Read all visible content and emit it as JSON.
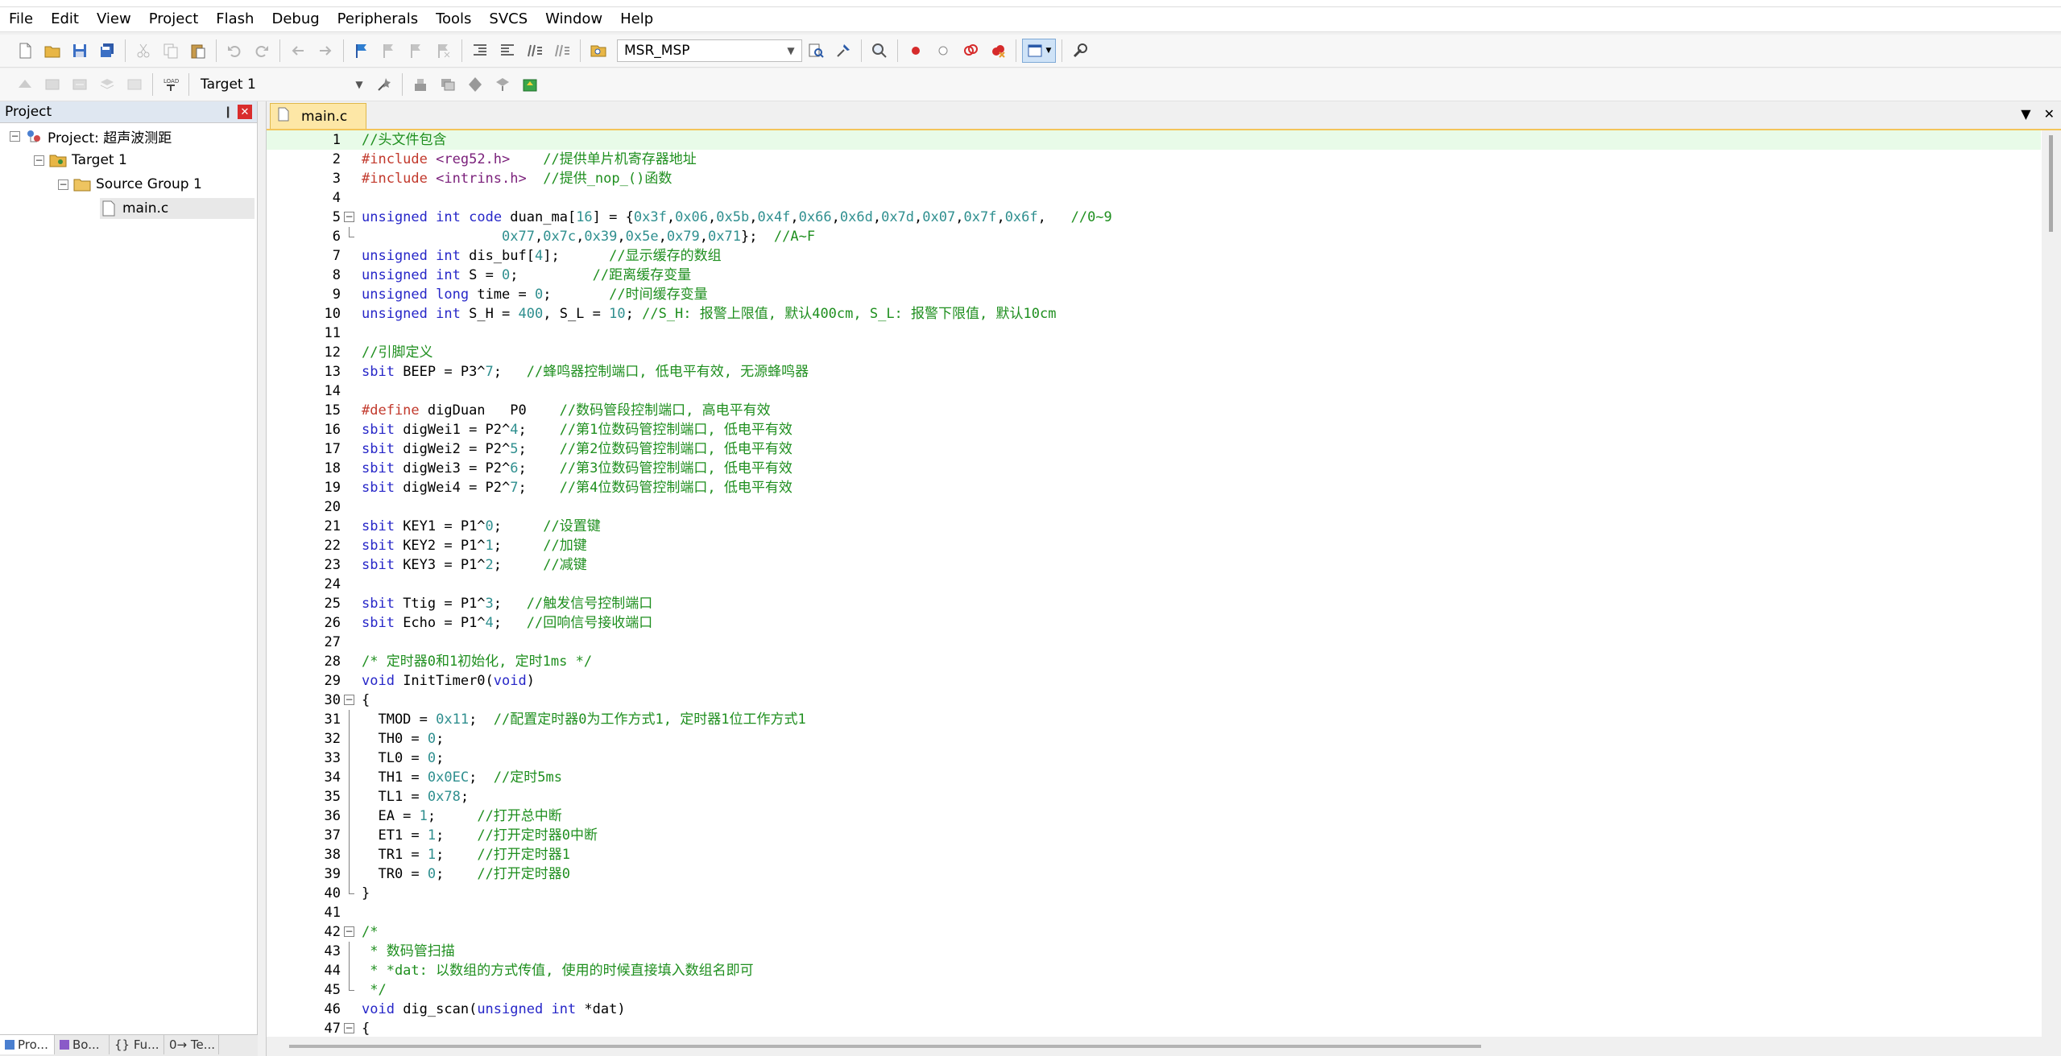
{
  "menu": [
    "File",
    "Edit",
    "View",
    "Project",
    "Flash",
    "Debug",
    "Peripherals",
    "Tools",
    "SVCS",
    "Window",
    "Help"
  ],
  "toolbar": {
    "find_combo_value": "MSR_MSP",
    "target_combo_value": "Target 1"
  },
  "project_panel": {
    "title": "Project",
    "pin_glyph": "❙",
    "close_glyph": "✕",
    "tree": {
      "root": "Project: 超声波测距",
      "target": "Target 1",
      "group": "Source Group 1",
      "file": "main.c"
    },
    "bottom_tabs": [
      "Pro...",
      "Bo...",
      "{} Fu...",
      "0→ Te..."
    ]
  },
  "editor": {
    "active_tab": "main.c",
    "tab_menu_glyph": "▼",
    "tab_close_glyph": "✕",
    "current_line": 1,
    "lines": [
      "//头文件包含",
      "#include <reg52.h>    //提供单片机寄存器地址",
      "#include <intrins.h>  //提供_nop_()函数",
      "",
      "unsigned int code duan_ma[16] = {0x3f,0x06,0x5b,0x4f,0x66,0x6d,0x7d,0x07,0x7f,0x6f,   //0~9",
      "                 0x77,0x7c,0x39,0x5e,0x79,0x71};  //A~F",
      "unsigned int dis_buf[4];      //显示缓存的数组",
      "unsigned int S = 0;         //距离缓存变量",
      "unsigned long time = 0;       //时间缓存变量",
      "unsigned int S_H = 400, S_L = 10; //S_H: 报警上限值, 默认400cm, S_L: 报警下限值, 默认10cm",
      "",
      "//引脚定义",
      "sbit BEEP = P3^7;   //蜂鸣器控制端口, 低电平有效, 无源蜂鸣器",
      "",
      "#define digDuan   P0    //数码管段控制端口, 高电平有效",
      "sbit digWei1 = P2^4;    //第1位数码管控制端口, 低电平有效",
      "sbit digWei2 = P2^5;    //第2位数码管控制端口, 低电平有效",
      "sbit digWei3 = P2^6;    //第3位数码管控制端口, 低电平有效",
      "sbit digWei4 = P2^7;    //第4位数码管控制端口, 低电平有效",
      "",
      "sbit KEY1 = P1^0;     //设置键",
      "sbit KEY2 = P1^1;     //加键",
      "sbit KEY3 = P1^2;     //减键",
      "",
      "sbit Ttig = P1^3;   //触发信号控制端口",
      "sbit Echo = P1^4;   //回响信号接收端口",
      "",
      "/* 定时器0和1初始化, 定时1ms */",
      "void InitTimer0(void)",
      "{",
      "  TMOD = 0x11;  //配置定时器0为工作方式1, 定时器1位工作方式1",
      "  TH0 = 0;",
      "  TL0 = 0;",
      "  TH1 = 0x0EC;  //定时5ms",
      "  TL1 = 0x78;",
      "  EA = 1;     //打开总中断",
      "  ET1 = 1;    //打开定时器0中断",
      "  TR1 = 1;    //打开定时器1",
      "  TR0 = 0;    //打开定时器0",
      "}",
      "",
      "/*",
      " * 数码管扫描",
      " * *dat: 以数组的方式传值, 使用的时候直接填入数组名即可",
      " */",
      "void dig_scan(unsigned int *dat)",
      "{"
    ]
  }
}
